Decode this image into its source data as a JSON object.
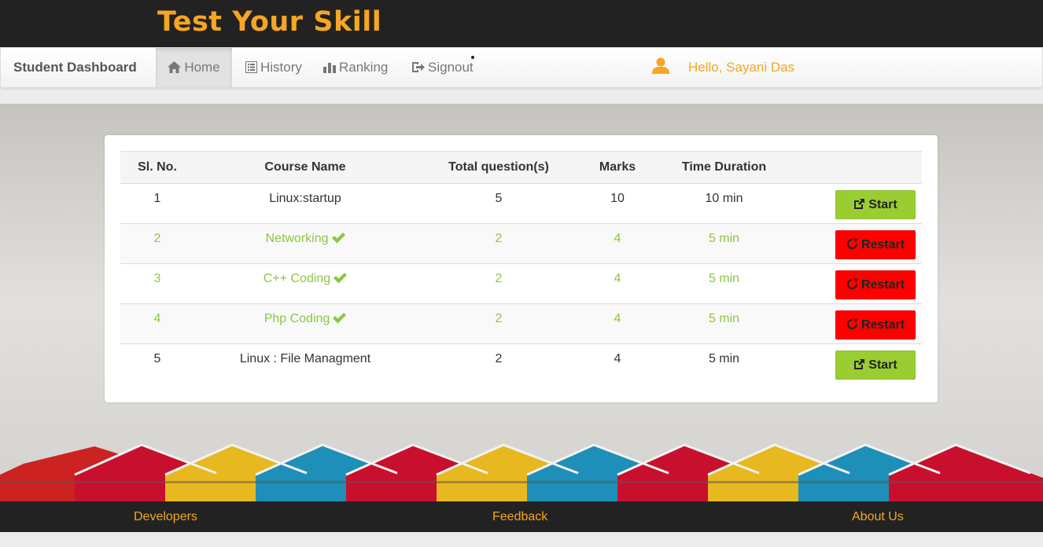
{
  "app": {
    "title": "Test Your Skill"
  },
  "navbar": {
    "brand": "Student Dashboard",
    "items": [
      {
        "label": "Home",
        "icon": "home-icon",
        "active": true
      },
      {
        "label": "History",
        "icon": "list-icon",
        "active": false
      },
      {
        "label": "Ranking",
        "icon": "bar-chart-icon",
        "active": false
      },
      {
        "label": "Signout",
        "icon": "logout-icon",
        "active": false
      }
    ],
    "greeting": "Hello, Sayani Das"
  },
  "table": {
    "headers": [
      "Sl. No.",
      "Course Name",
      "Total question(s)",
      "Marks",
      "Time Duration",
      ""
    ],
    "rows": [
      {
        "sl": "1",
        "course": "Linux:startup",
        "questions": "5",
        "marks": "10",
        "duration": "10 min",
        "action": "Start",
        "completed": false
      },
      {
        "sl": "2",
        "course": "Networking",
        "questions": "2",
        "marks": "4",
        "duration": "5 min",
        "action": "Restart",
        "completed": true
      },
      {
        "sl": "3",
        "course": "C++ Coding",
        "questions": "2",
        "marks": "4",
        "duration": "5 min",
        "action": "Restart",
        "completed": true
      },
      {
        "sl": "4",
        "course": "Php Coding",
        "questions": "2",
        "marks": "4",
        "duration": "5 min",
        "action": "Restart",
        "completed": true
      },
      {
        "sl": "5",
        "course": "Linux : File Managment",
        "questions": "2",
        "marks": "4",
        "duration": "5 min",
        "action": "Start",
        "completed": false
      }
    ]
  },
  "footer": {
    "links": [
      "Developers",
      "Feedback",
      "About Us"
    ]
  },
  "colors": {
    "accent": "#f5a623",
    "header_bg": "#222222",
    "completed_text": "#8cc63f",
    "start_button": "#9acd32",
    "restart_button": "#ff0000"
  }
}
